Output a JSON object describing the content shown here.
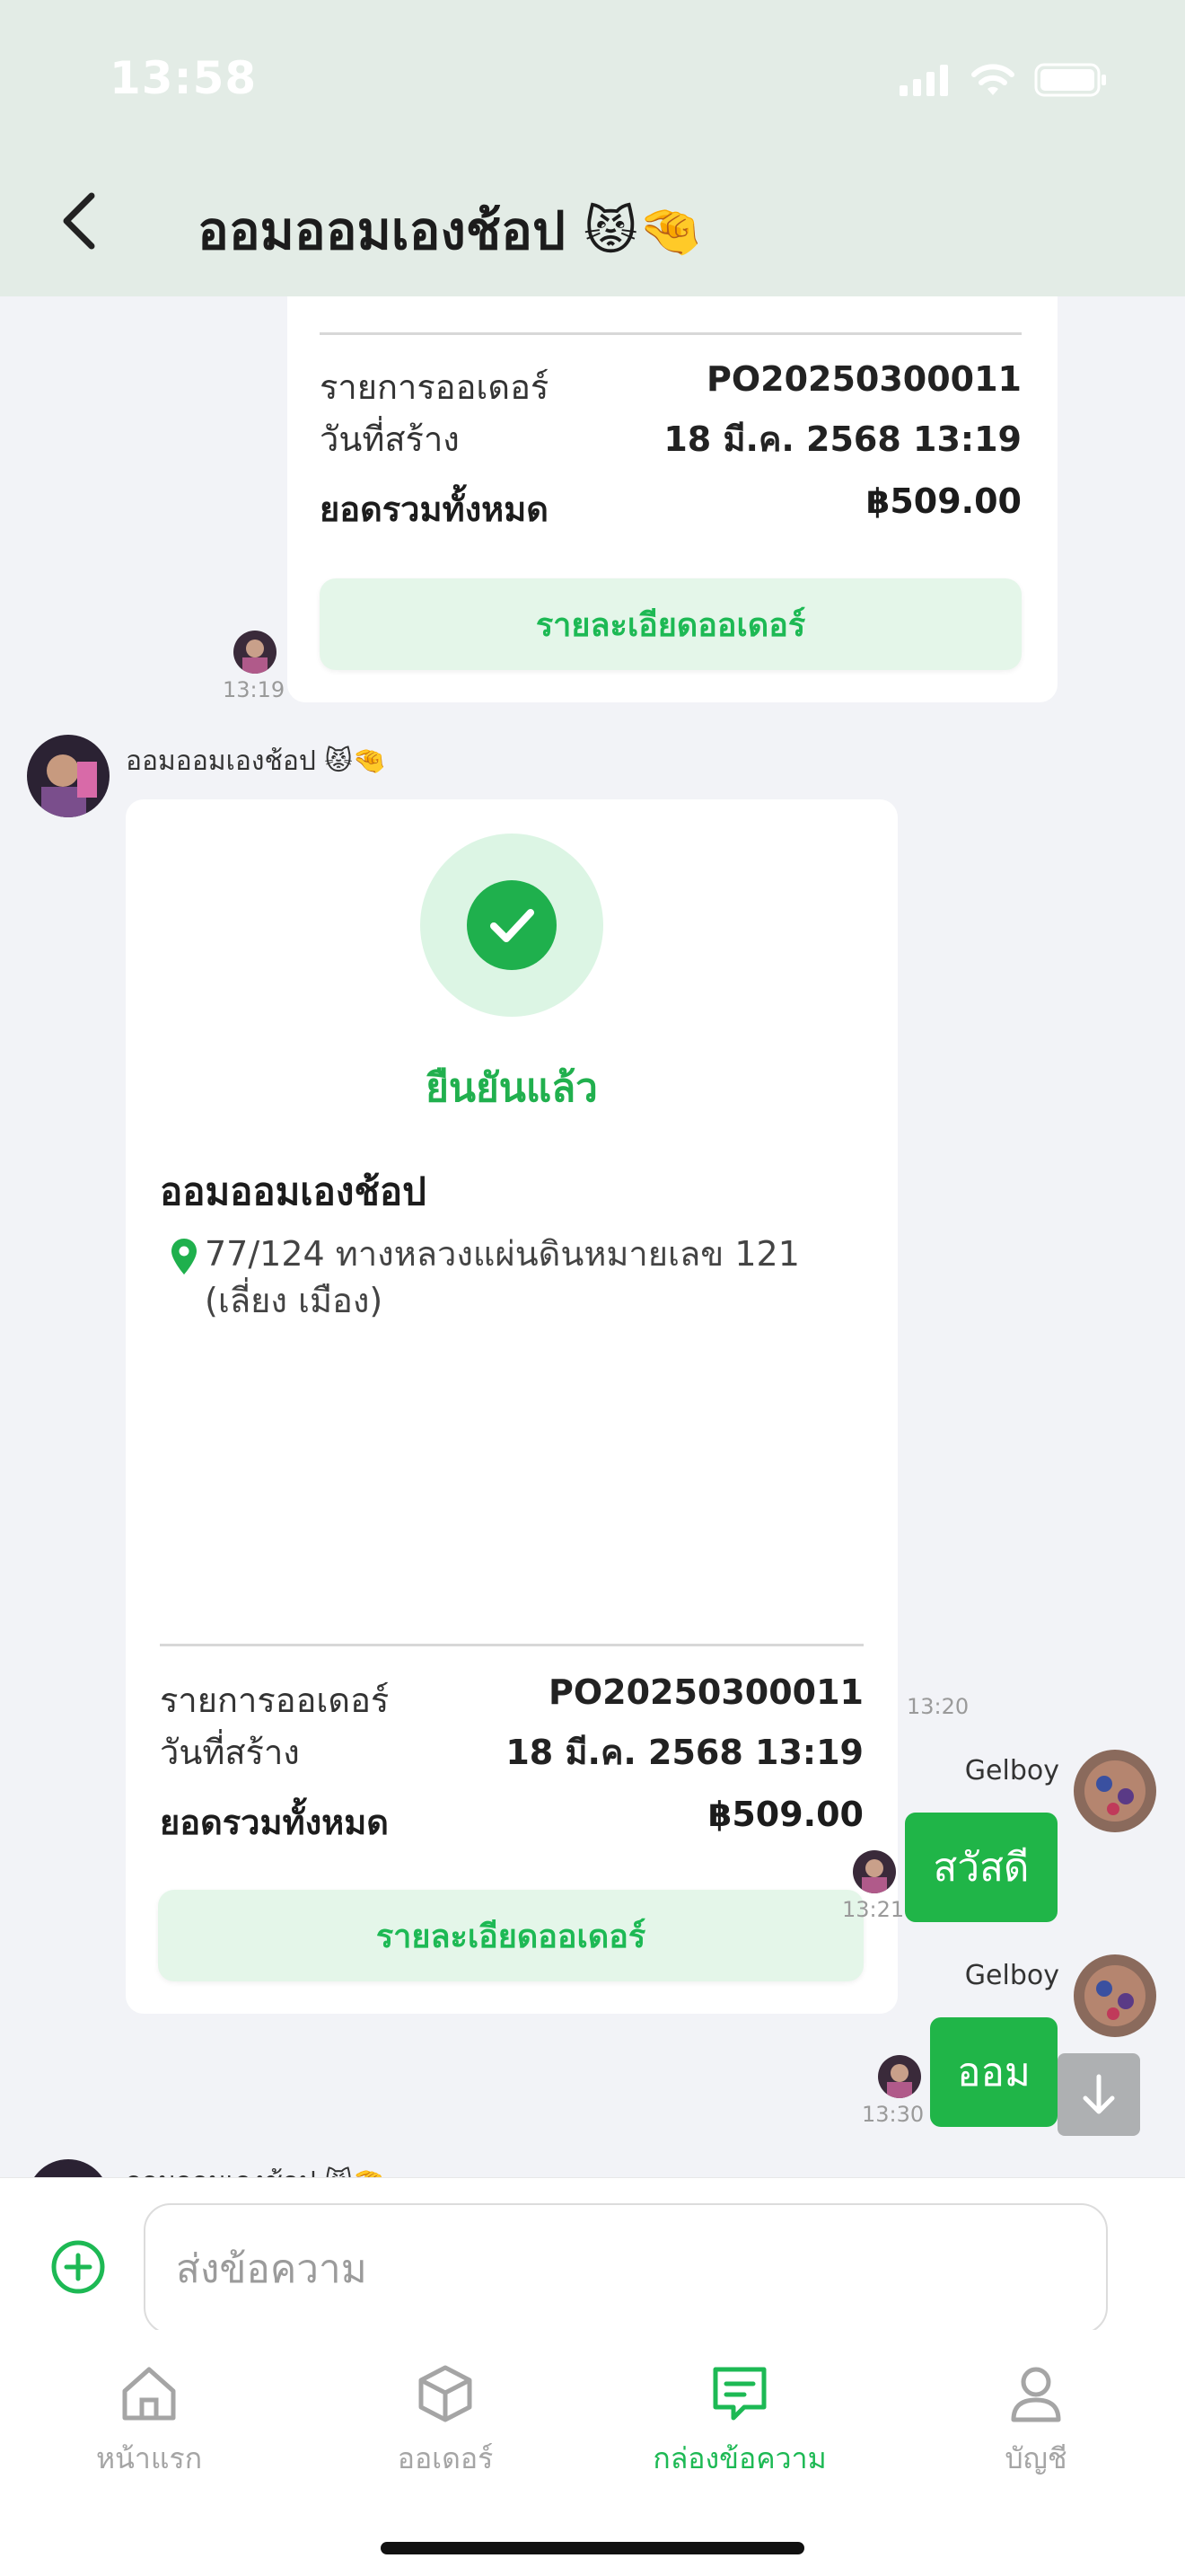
{
  "status_bar": {
    "time": "13:58"
  },
  "header": {
    "title": "ออมออมเองช้อป 😾🤏"
  },
  "order_card_1": {
    "order_label": "รายการออเดอร์",
    "order_value": "PO20250300011",
    "date_label": "วันที่สร้าง",
    "date_value": "18 มี.ค. 2568 13:19",
    "total_label": "ยอดรวมทั้งหมด",
    "total_value": "฿509.00",
    "button": "รายละเอียดออเดอร์",
    "time": "13:19"
  },
  "shop_message": {
    "sender": "ออมออมเองช้อป 😾🤏",
    "status": "ยืนยันแล้ว",
    "shop_name": "ออมออมเองช้อป",
    "address": "77/124 ทางหลวงแผ่นดินหมายเลข 121 (เลี่ยง เมือง)",
    "order_label": "รายการออเดอร์",
    "order_value": "PO20250300011",
    "date_label": "วันที่สร้าง",
    "date_value": "18 มี.ค. 2568 13:19",
    "total_label": "ยอดรวมทั้งหมด",
    "total_value": "฿509.00",
    "button": "รายละเอียดออเดอร์",
    "time": "13:20"
  },
  "user_messages": [
    {
      "sender": "Gelboy",
      "text": "สวัสดี",
      "time": "13:21"
    },
    {
      "sender": "Gelboy",
      "text": "ออม",
      "time": "13:30"
    }
  ],
  "partial_sender": "ออมออมเองช้อป 😾🤏",
  "composer": {
    "placeholder": "ส่งข้อความ"
  },
  "nav": {
    "items": [
      {
        "label": "หน้าแรก",
        "icon": "home-icon"
      },
      {
        "label": "ออเดอร์",
        "icon": "box-icon"
      },
      {
        "label": "กล่องข้อความ",
        "icon": "message-icon",
        "active": true
      },
      {
        "label": "บัญชี",
        "icon": "user-icon"
      }
    ]
  },
  "colors": {
    "accent": "#1db954",
    "bubble": "#20b548",
    "header_bg": "#e3ece6",
    "chat_bg": "#f2f3f7"
  }
}
